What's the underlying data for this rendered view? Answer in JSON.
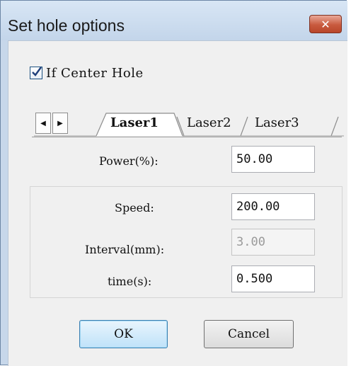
{
  "window": {
    "title": "Set hole options",
    "close_symbol": "✕"
  },
  "center_hole": {
    "label": "If Center Hole",
    "checked": true
  },
  "tabs": {
    "scroll_left_symbol": "◀",
    "scroll_right_symbol": "▶",
    "items": [
      {
        "label": "Laser1",
        "active": true
      },
      {
        "label": "Laser2",
        "active": false
      },
      {
        "label": "Laser3",
        "active": false
      }
    ]
  },
  "fields": {
    "power": {
      "label": "Power(%):",
      "value": "50.00"
    },
    "speed": {
      "label": "Speed:",
      "value": "200.00"
    },
    "interval": {
      "label": "Interval(mm):",
      "value": "3.00",
      "disabled": true
    },
    "time": {
      "label": "time(s):",
      "value": "0.500"
    }
  },
  "buttons": {
    "ok": "OK",
    "cancel": "Cancel"
  }
}
